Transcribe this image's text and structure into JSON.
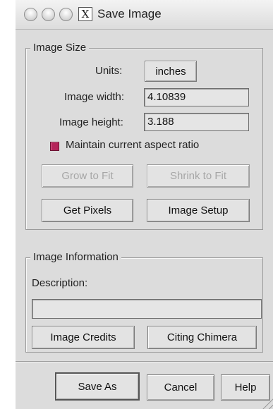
{
  "window": {
    "title": "Save Image"
  },
  "image_size": {
    "legend": "Image Size",
    "units_label": "Units:",
    "units_value": "inches",
    "width_label": "Image width:",
    "width_value": "4.10839",
    "height_label": "Image height:",
    "height_value": "3.188",
    "aspect_label": "Maintain current aspect ratio",
    "aspect_checked": true,
    "grow_label": "Grow to Fit",
    "shrink_label": "Shrink to Fit",
    "get_pixels_label": "Get Pixels",
    "image_setup_label": "Image Setup"
  },
  "image_info": {
    "legend": "Image Information",
    "description_label": "Description:",
    "description_value": "",
    "credits_label": "Image Credits",
    "citing_label": "Citing Chimera"
  },
  "footer": {
    "save_as_label": "Save As",
    "cancel_label": "Cancel",
    "help_label": "Help"
  },
  "colors": {
    "checkbox": "#b5245a",
    "dialog_bg": "#dcdcdc"
  },
  "icons": {
    "window_buttons": [
      "close-button-icon",
      "minimize-button-icon",
      "zoom-button-icon"
    ],
    "x11": "x11-icon"
  }
}
